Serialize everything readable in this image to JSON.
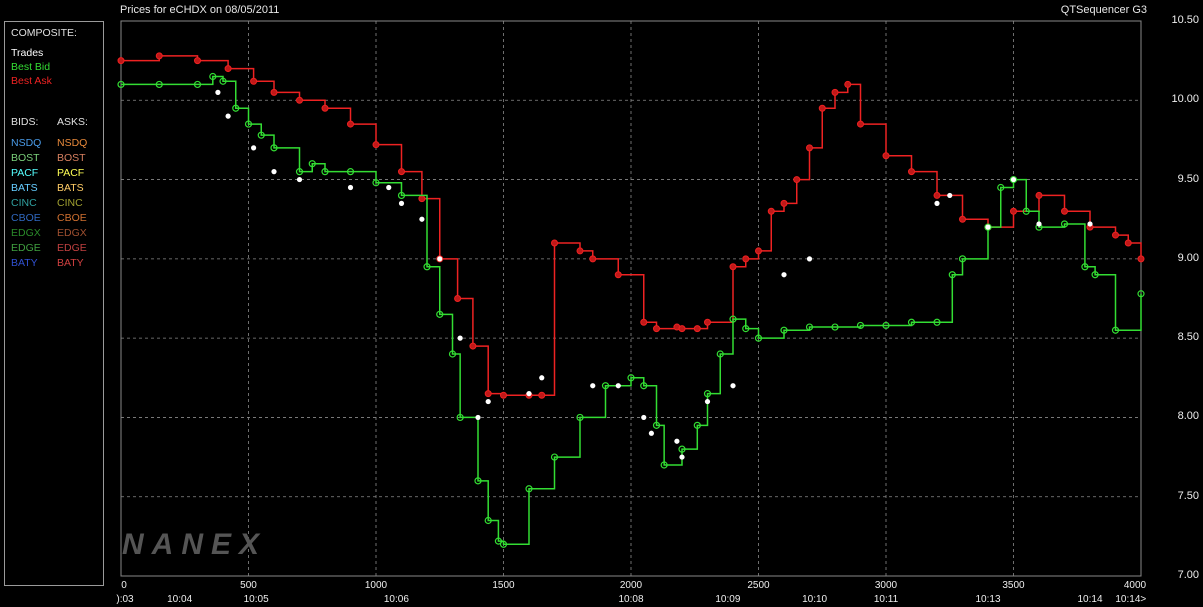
{
  "header": {
    "title": "Prices for  eCHDX  on  08/05/2011",
    "app_name": "QTSequencer G3"
  },
  "legend": {
    "composite_title": "COMPOSITE:",
    "composite_items": [
      {
        "label": "Trades",
        "color": "#ffffff"
      },
      {
        "label": "Best Bid",
        "color": "#33dd33"
      },
      {
        "label": "Best Ask",
        "color": "#ee2222"
      }
    ],
    "bids_title": "BIDS:",
    "asks_title": "ASKS:",
    "exchanges": [
      {
        "bid": "NSDQ",
        "bid_color": "#4a9be8",
        "ask": "NSDQ",
        "ask_color": "#e8893a"
      },
      {
        "bid": "BOST",
        "bid_color": "#7ad07a",
        "ask": "BOST",
        "ask_color": "#d88060"
      },
      {
        "bid": "PACF",
        "bid_color": "#55ffff",
        "ask": "PACF",
        "ask_color": "#ffff55"
      },
      {
        "bid": "BATS",
        "bid_color": "#66ccff",
        "ask": "BATS",
        "ask_color": "#ffcc66"
      },
      {
        "bid": "CINC",
        "bid_color": "#30a0a0",
        "ask": "CINC",
        "ask_color": "#a0a030"
      },
      {
        "bid": "CBOE",
        "bid_color": "#3068c0",
        "ask": "CBOE",
        "ask_color": "#d07030"
      },
      {
        "bid": "EDGX",
        "bid_color": "#2a8a2a",
        "ask": "EDGX",
        "ask_color": "#a05030"
      },
      {
        "bid": "EDGE",
        "bid_color": "#40a040",
        "ask": "EDGE",
        "ask_color": "#c04040"
      },
      {
        "bid": "BATY",
        "bid_color": "#3050d0",
        "ask": "BATY",
        "ask_color": "#d04040"
      }
    ]
  },
  "watermark": "NANEX",
  "chart_data": {
    "type": "line",
    "title": "Prices for  eCHDX  on  08/05/2011",
    "x_seq_ticks": [
      "0",
      "500",
      "1000",
      "1500",
      "2000",
      "2500",
      "3000",
      "3500",
      "4000"
    ],
    "x_time_ticks": [
      "):03",
      "10:04",
      "10:05",
      "10:06",
      "10:08",
      "10:09",
      "10:10",
      "10:11",
      "10:13",
      "10:14",
      "10:14>"
    ],
    "y_tick_labels": [
      "10.50",
      "10.00",
      "9.50",
      "9.00",
      "8.50",
      "8.00",
      "7.50",
      "7.00"
    ],
    "ylim": [
      7.0,
      10.5
    ],
    "xlim": [
      0,
      4000
    ],
    "grid": true,
    "legend_position": "left",
    "series": [
      {
        "name": "Best Ask",
        "color": "#ee2222",
        "x": [
          0,
          150,
          300,
          420,
          520,
          600,
          700,
          800,
          900,
          1000,
          1100,
          1180,
          1250,
          1320,
          1380,
          1440,
          1500,
          1600,
          1650,
          1700,
          1800,
          1850,
          1950,
          2050,
          2100,
          2180,
          2200,
          2260,
          2300,
          2400,
          2450,
          2500,
          2550,
          2600,
          2650,
          2700,
          2750,
          2800,
          2850,
          2900,
          3000,
          3100,
          3200,
          3300,
          3400,
          3500,
          3600,
          3700,
          3800,
          3900,
          3950,
          4000
        ],
        "y": [
          10.25,
          10.28,
          10.25,
          10.2,
          10.12,
          10.05,
          10.0,
          9.95,
          9.85,
          9.72,
          9.55,
          9.38,
          9.0,
          8.75,
          8.45,
          8.15,
          8.14,
          8.14,
          8.14,
          9.1,
          9.05,
          9.0,
          8.9,
          8.6,
          8.56,
          8.57,
          8.56,
          8.56,
          8.6,
          8.95,
          9.0,
          9.05,
          9.3,
          9.35,
          9.5,
          9.7,
          9.95,
          10.05,
          10.1,
          9.85,
          9.65,
          9.55,
          9.4,
          9.25,
          9.2,
          9.3,
          9.4,
          9.3,
          9.2,
          9.15,
          9.1,
          9.0
        ]
      },
      {
        "name": "Best Bid",
        "color": "#33dd33",
        "x": [
          0,
          150,
          300,
          360,
          400,
          450,
          500,
          550,
          600,
          700,
          750,
          800,
          900,
          1000,
          1100,
          1200,
          1250,
          1300,
          1330,
          1400,
          1440,
          1480,
          1500,
          1600,
          1700,
          1800,
          1900,
          2000,
          2050,
          2100,
          2130,
          2200,
          2260,
          2300,
          2350,
          2400,
          2450,
          2500,
          2600,
          2700,
          2800,
          2900,
          3000,
          3100,
          3200,
          3260,
          3300,
          3400,
          3450,
          3500,
          3550,
          3600,
          3700,
          3780,
          3820,
          3900,
          4000
        ],
        "y": [
          10.1,
          10.1,
          10.1,
          10.15,
          10.12,
          9.95,
          9.85,
          9.78,
          9.7,
          9.55,
          9.6,
          9.55,
          9.55,
          9.48,
          9.4,
          8.95,
          8.65,
          8.4,
          8.0,
          7.6,
          7.35,
          7.22,
          7.2,
          7.55,
          7.75,
          8.0,
          8.2,
          8.25,
          8.2,
          7.95,
          7.7,
          7.8,
          7.95,
          8.15,
          8.4,
          8.62,
          8.56,
          8.5,
          8.55,
          8.57,
          8.57,
          8.58,
          8.58,
          8.6,
          8.6,
          8.9,
          9.0,
          9.2,
          9.45,
          9.5,
          9.3,
          9.2,
          9.22,
          8.95,
          8.9,
          8.55,
          8.78
        ]
      },
      {
        "name": "Trades",
        "color": "#ffffff",
        "x": [
          380,
          420,
          520,
          600,
          700,
          900,
          1050,
          1100,
          1180,
          1250,
          1330,
          1400,
          1440,
          1600,
          1650,
          1850,
          1950,
          2050,
          2080,
          2180,
          2200,
          2300,
          2400,
          2600,
          2700,
          3200,
          3250,
          3400,
          3500,
          3600,
          3800
        ],
        "y": [
          10.05,
          9.9,
          9.7,
          9.55,
          9.5,
          9.45,
          9.45,
          9.35,
          9.25,
          9.0,
          8.5,
          8.0,
          8.1,
          8.15,
          8.25,
          8.2,
          8.2,
          8.0,
          7.9,
          7.85,
          7.75,
          8.1,
          8.2,
          8.9,
          9.0,
          9.35,
          9.4,
          9.2,
          9.5,
          9.22,
          9.22
        ]
      }
    ]
  }
}
